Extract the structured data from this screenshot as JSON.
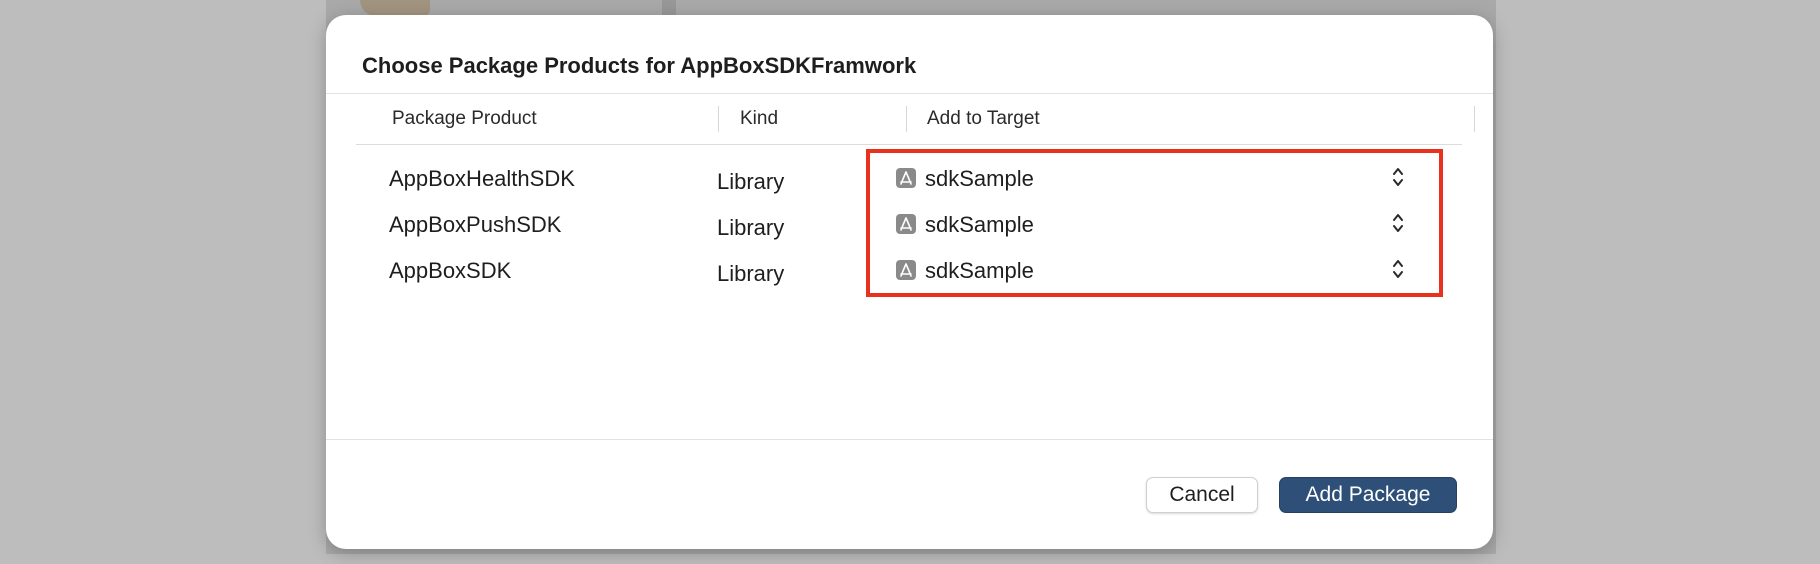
{
  "dialog": {
    "title": "Choose Package Products for AppBoxSDKFramwork"
  },
  "table": {
    "columns": [
      "Package Product",
      "Kind",
      "Add to Target"
    ],
    "rows": [
      {
        "product": "AppBoxHealthSDK",
        "kind": "Library",
        "target": "sdkSample"
      },
      {
        "product": "AppBoxPushSDK",
        "kind": "Library",
        "target": "sdkSample"
      },
      {
        "product": "AppBoxSDK",
        "kind": "Library",
        "target": "sdkSample"
      }
    ]
  },
  "buttons": {
    "cancel": "Cancel",
    "add": "Add Package"
  },
  "colors": {
    "primary_button": "#2e5078",
    "highlight": "#e8321e"
  },
  "icons": {
    "target": "app-target-icon",
    "stepper": "up-down-chevron-icon"
  }
}
